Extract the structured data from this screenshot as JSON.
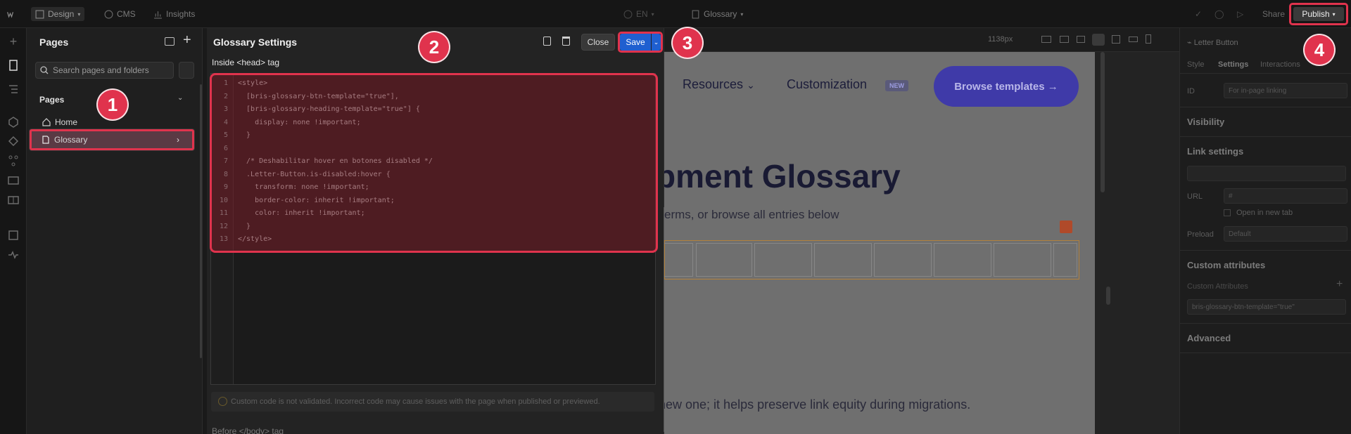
{
  "topbar": {
    "mode_label": "Design",
    "cms_label": "CMS",
    "insights_label": "Insights",
    "locale_label": "EN",
    "page_label": "Glossary",
    "share_label": "Share",
    "publish_label": "Publish"
  },
  "pages_panel": {
    "title": "Pages",
    "search_placeholder": "Search pages and folders",
    "section_label": "Pages",
    "items": [
      {
        "label": "Home"
      },
      {
        "label": "Glossary"
      }
    ]
  },
  "settings_panel": {
    "title": "Glossary Settings",
    "head_tag_label": "Inside <head> tag",
    "close_label": "Close",
    "save_label": "Save",
    "code_lines": [
      "<style>",
      "  [bris-glossary-btn-template=\"true\"],",
      "  [bris-glossary-heading-template=\"true\"] {",
      "    display: none !important;",
      "  }",
      "",
      "  /* Deshabilitar hover en botones disabled */",
      "  .Letter-Button.is-disabled:hover {",
      "    transform: none !important;",
      "    border-color: inherit !important;",
      "    color: inherit !important;",
      "  }",
      "</style>"
    ],
    "line_numbers": [
      "1",
      "2",
      "3",
      "4",
      "5",
      "6",
      "7",
      "8",
      "9",
      "10",
      "11",
      "12",
      "13"
    ],
    "warning_text": "Custom code is not validated. Incorrect code may cause issues with the page when published or previewed.",
    "body_tag_label": "Before </body> tag"
  },
  "canvas": {
    "width_label": "1138px",
    "nav": {
      "resources": "Resources",
      "customization": "Customization",
      "new_badge": "NEW",
      "browse_button": "Browse templates →"
    },
    "hero_title": "pment Glossary",
    "hero_sub": "erms, or browse all entries below",
    "bottom_text": "new one; it helps preserve link equity during migrations."
  },
  "right_panel": {
    "element_name": "Letter Button",
    "tabs": [
      "Style",
      "Settings",
      "Interactions"
    ],
    "id_label": "ID",
    "id_placeholder": "For in-page linking",
    "visibility_label": "Visibility",
    "link_settings_label": "Link settings",
    "url_label": "URL",
    "url_value": "#",
    "new_tab_label": "Open in new tab",
    "preload_label": "Preload",
    "preload_value": "Default",
    "custom_attr_label": "Custom attributes",
    "custom_attr_sub": "Custom Attributes",
    "attr_value": "bris-glossary-btn-template=\"true\"",
    "advanced_label": "Advanced"
  },
  "badges": [
    "1",
    "2",
    "3",
    "4"
  ],
  "colors": {
    "highlight": "#e0334d",
    "save_blue": "#1f5fd0",
    "canvas_button": "#3f3aa8"
  }
}
